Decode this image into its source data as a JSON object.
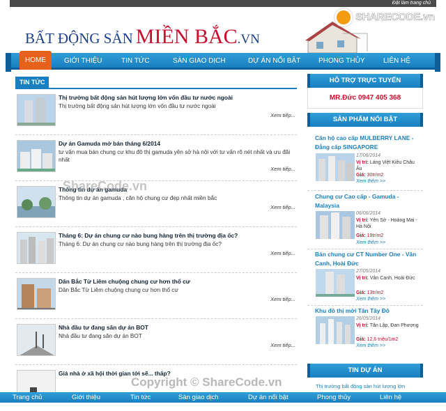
{
  "topbar": {
    "login": "Đặt làm trang chủ"
  },
  "logo": {
    "part1": "BẤT ĐỘNG SẢN",
    "part2": "MIỀN BẮC",
    "part3": ".VN"
  },
  "sharecode_logo": "SHARECODE.vn",
  "nav": [
    "HOME",
    "GIỚI THIỆU",
    "TIN TỨC",
    "SÀN GIAO DỊCH",
    "DỰ ÁN NỔI BẬT",
    "PHONG THỦY",
    "LIÊN HỆ"
  ],
  "news": {
    "heading": "TIN TỨC",
    "more_label": "Xem tiếp...",
    "articles": [
      {
        "title": "Thị trường bất động sản hút lượng lớn vốn đầu tư nước ngoài",
        "desc": "Thị trường bất động sản hút lượng lớn vốn đầu tư nước ngoài"
      },
      {
        "title": "Dự án Gamuda mở bán tháng 6/2014",
        "desc": "tư vấn mua bán chung cư khu đô thị gamuda yên sở hà nội với tư vấn rõ nét nhất và ưu đãi nhất"
      },
      {
        "title": "Thông tin dự án gamuda",
        "desc": "Thông tin dự án gamuda , căn hộ chung cư đẹp nhất miền bắc"
      },
      {
        "title": "Tháng 6: Dự án chung cư nào bung hàng trên thị trường địa ốc?",
        "desc": "Tháng 6: Dự án chung cư nào bung hàng trên thị trường địa ốc?"
      },
      {
        "title": "Dân Bắc Từ Liêm chuộng chung cư hơn thổ cư",
        "desc": "Dân Bắc Từ Liêm chuộng chung cư hơn thổ cư"
      },
      {
        "title": "Nhà đầu tư đang săn dự án BOT",
        "desc": "Nhà đầu tư đang săn dự án BOT"
      },
      {
        "title": "Giá nhà ở xã hội thời gian tới sẽ... thấp?",
        "desc": ""
      }
    ]
  },
  "support": {
    "heading": "HỖ TRỢ TRỰC TUYẾN",
    "contact": "MR.Đức 0947 405 368"
  },
  "featured": {
    "heading": "SẢN PHẨM NỔI BẬT",
    "loc_label": "Vị trí:",
    "price_label": "Giá:",
    "more_label": "Xem thêm >>",
    "items": [
      {
        "title": "Căn hộ cao cấp MULBERRY LANE - Đẳng cấp SINGAPORE",
        "date": "17/06/2014",
        "location": "Láng Việt Kiều Châu Âu",
        "price": "30tr/m2"
      },
      {
        "title": "Chung cư Cao cấp - Gamuda - Malaysia",
        "date": "06/06/2014",
        "location": "Yên Sở - Hoàng Mai - Hà Nội",
        "price": "19tr/m2"
      },
      {
        "title": "Bán chung cư CT Number One - Văn Canh, Hoài Đức",
        "date": "27/05/2014",
        "location": "Vân Canh, Hoài Đức",
        "price": "13tr/m2"
      },
      {
        "title": "Khu đô thị mới Tân Tây Đô",
        "date": "26/05/2014",
        "location": "Tân Lập, Đan Phượng",
        "price": "12,6 triệu/1m2"
      }
    ]
  },
  "projects": {
    "heading": "TIN DỰ ÁN",
    "first": "Thị trường bất động sản hút lượng lớn"
  },
  "footer": [
    "Trang chủ",
    "Giới thiệu",
    "Tin tức",
    "Sàn giao dịch",
    "Dự án nổi bật",
    "Phong thủy",
    "Liên hệ"
  ],
  "watermark": "ShareCode.vn",
  "copyright": "Copyright © ShareCode.vn"
}
